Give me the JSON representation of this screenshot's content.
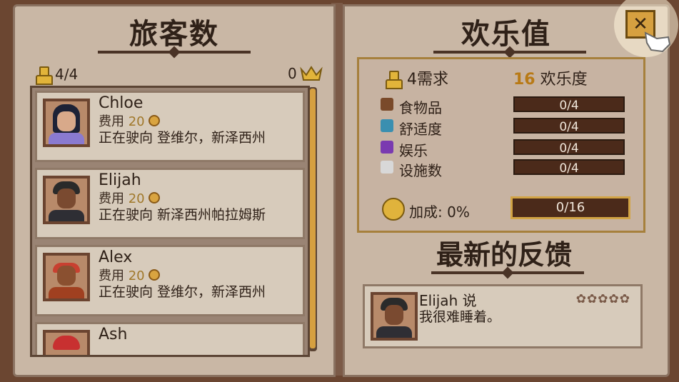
{
  "left_page": {
    "title": "旅客数",
    "guest_count": "4/4",
    "crown_count": "0",
    "guests": [
      {
        "name": "Chloe",
        "cost_label": "费用",
        "cost": "20",
        "status": "正在驶向 登维尔，新泽西州"
      },
      {
        "name": "Elijah",
        "cost_label": "费用",
        "cost": "20",
        "status": "正在驶向 新泽西州帕拉姆斯"
      },
      {
        "name": "Alex",
        "cost_label": "费用",
        "cost": "20",
        "status": "正在驶向 登维尔，新泽西州"
      },
      {
        "name": "Ash",
        "cost_label": "",
        "cost": "",
        "status": ""
      }
    ]
  },
  "right_page": {
    "title": "欢乐值",
    "needs_header": "4需求",
    "fun_value": "16",
    "fun_label": "欢乐度",
    "needs": [
      {
        "label": "食物品",
        "value": "0/4",
        "icon": "food-icon",
        "color": "#7a4a2a"
      },
      {
        "label": "舒适度",
        "value": "0/4",
        "icon": "comfort-icon",
        "color": "#3a8fb0"
      },
      {
        "label": "娱乐",
        "value": "0/4",
        "icon": "music-icon",
        "color": "#7a3ab0"
      },
      {
        "label": "设施数",
        "value": "0/4",
        "icon": "toilet-icon",
        "color": "#d8d8d8"
      }
    ],
    "bonus_label": "加成: 0%",
    "bonus_value": "0/16",
    "feedback_title": "最新的反馈",
    "feedback": {
      "name": "Elijah 说",
      "text": "我很难睡着。",
      "stars": "✿✿✿✿✿"
    }
  },
  "close_label": "✕"
}
